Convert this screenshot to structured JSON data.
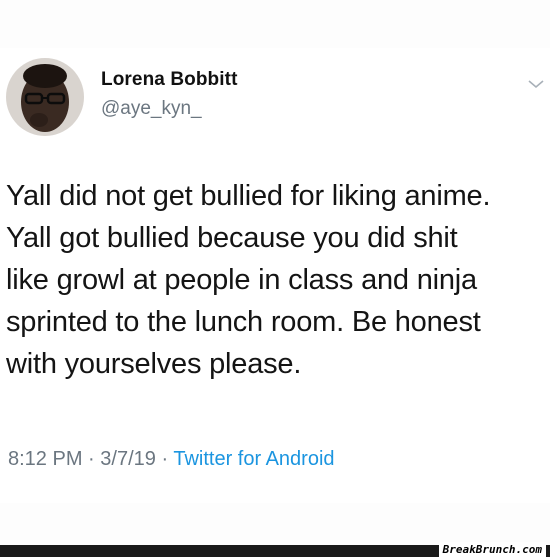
{
  "tweet": {
    "display_name": "Lorena Bobbitt",
    "handle": "@aye_kyn_",
    "text_lines": [
      "Yall did not get bullied for liking anime.",
      "Yall got bullied because you did shit",
      "like growl at people in class and ninja",
      "sprinted to the lunch room. Be honest",
      "with yourselves please."
    ],
    "time": "8:12 PM",
    "date": "3/7/19",
    "separator": "·",
    "source": "Twitter for Android",
    "avatar_icon": "user-avatar-photo",
    "menu_icon": "chevron-down-icon"
  },
  "watermark": "BreakBrunch.com",
  "colors": {
    "link": "#1b95e0",
    "muted": "#6b7680",
    "text": "#141414"
  }
}
